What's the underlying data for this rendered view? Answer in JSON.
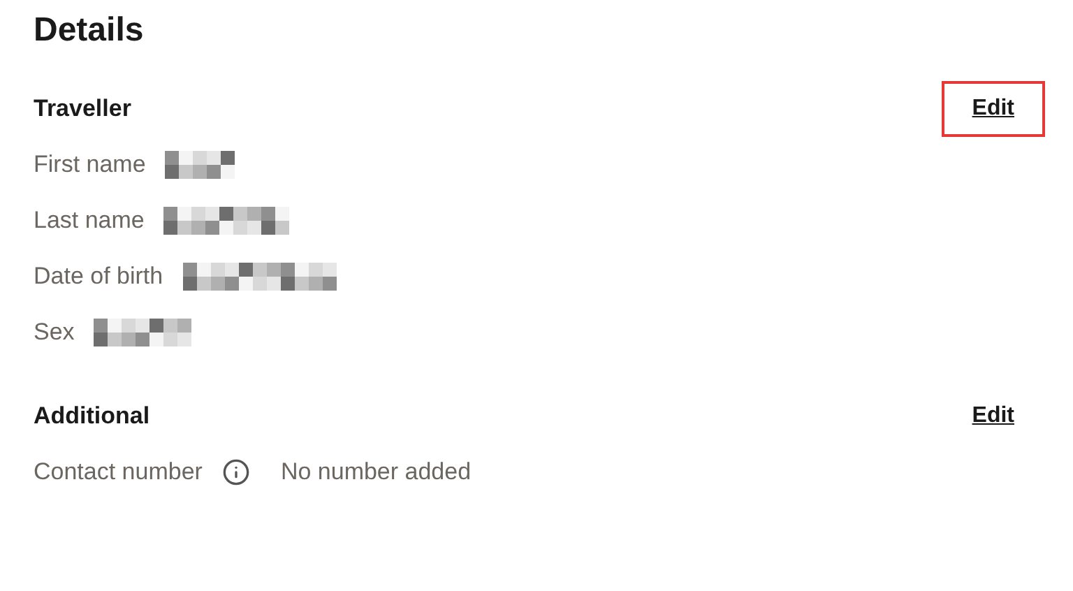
{
  "title": "Details",
  "sections": [
    {
      "heading": "Traveller",
      "edit": {
        "label": "Edit",
        "highlighted": true
      },
      "rows": [
        {
          "label": "First name",
          "kind": "redacted"
        },
        {
          "label": "Last name",
          "kind": "redacted"
        },
        {
          "label": "Date of birth",
          "kind": "redacted"
        },
        {
          "label": "Sex",
          "kind": "redacted"
        }
      ]
    },
    {
      "heading": "Additional",
      "edit": {
        "label": "Edit",
        "highlighted": false
      },
      "rows": [
        {
          "label": "Contact number",
          "kind": "info",
          "value": "No number added"
        }
      ]
    }
  ]
}
